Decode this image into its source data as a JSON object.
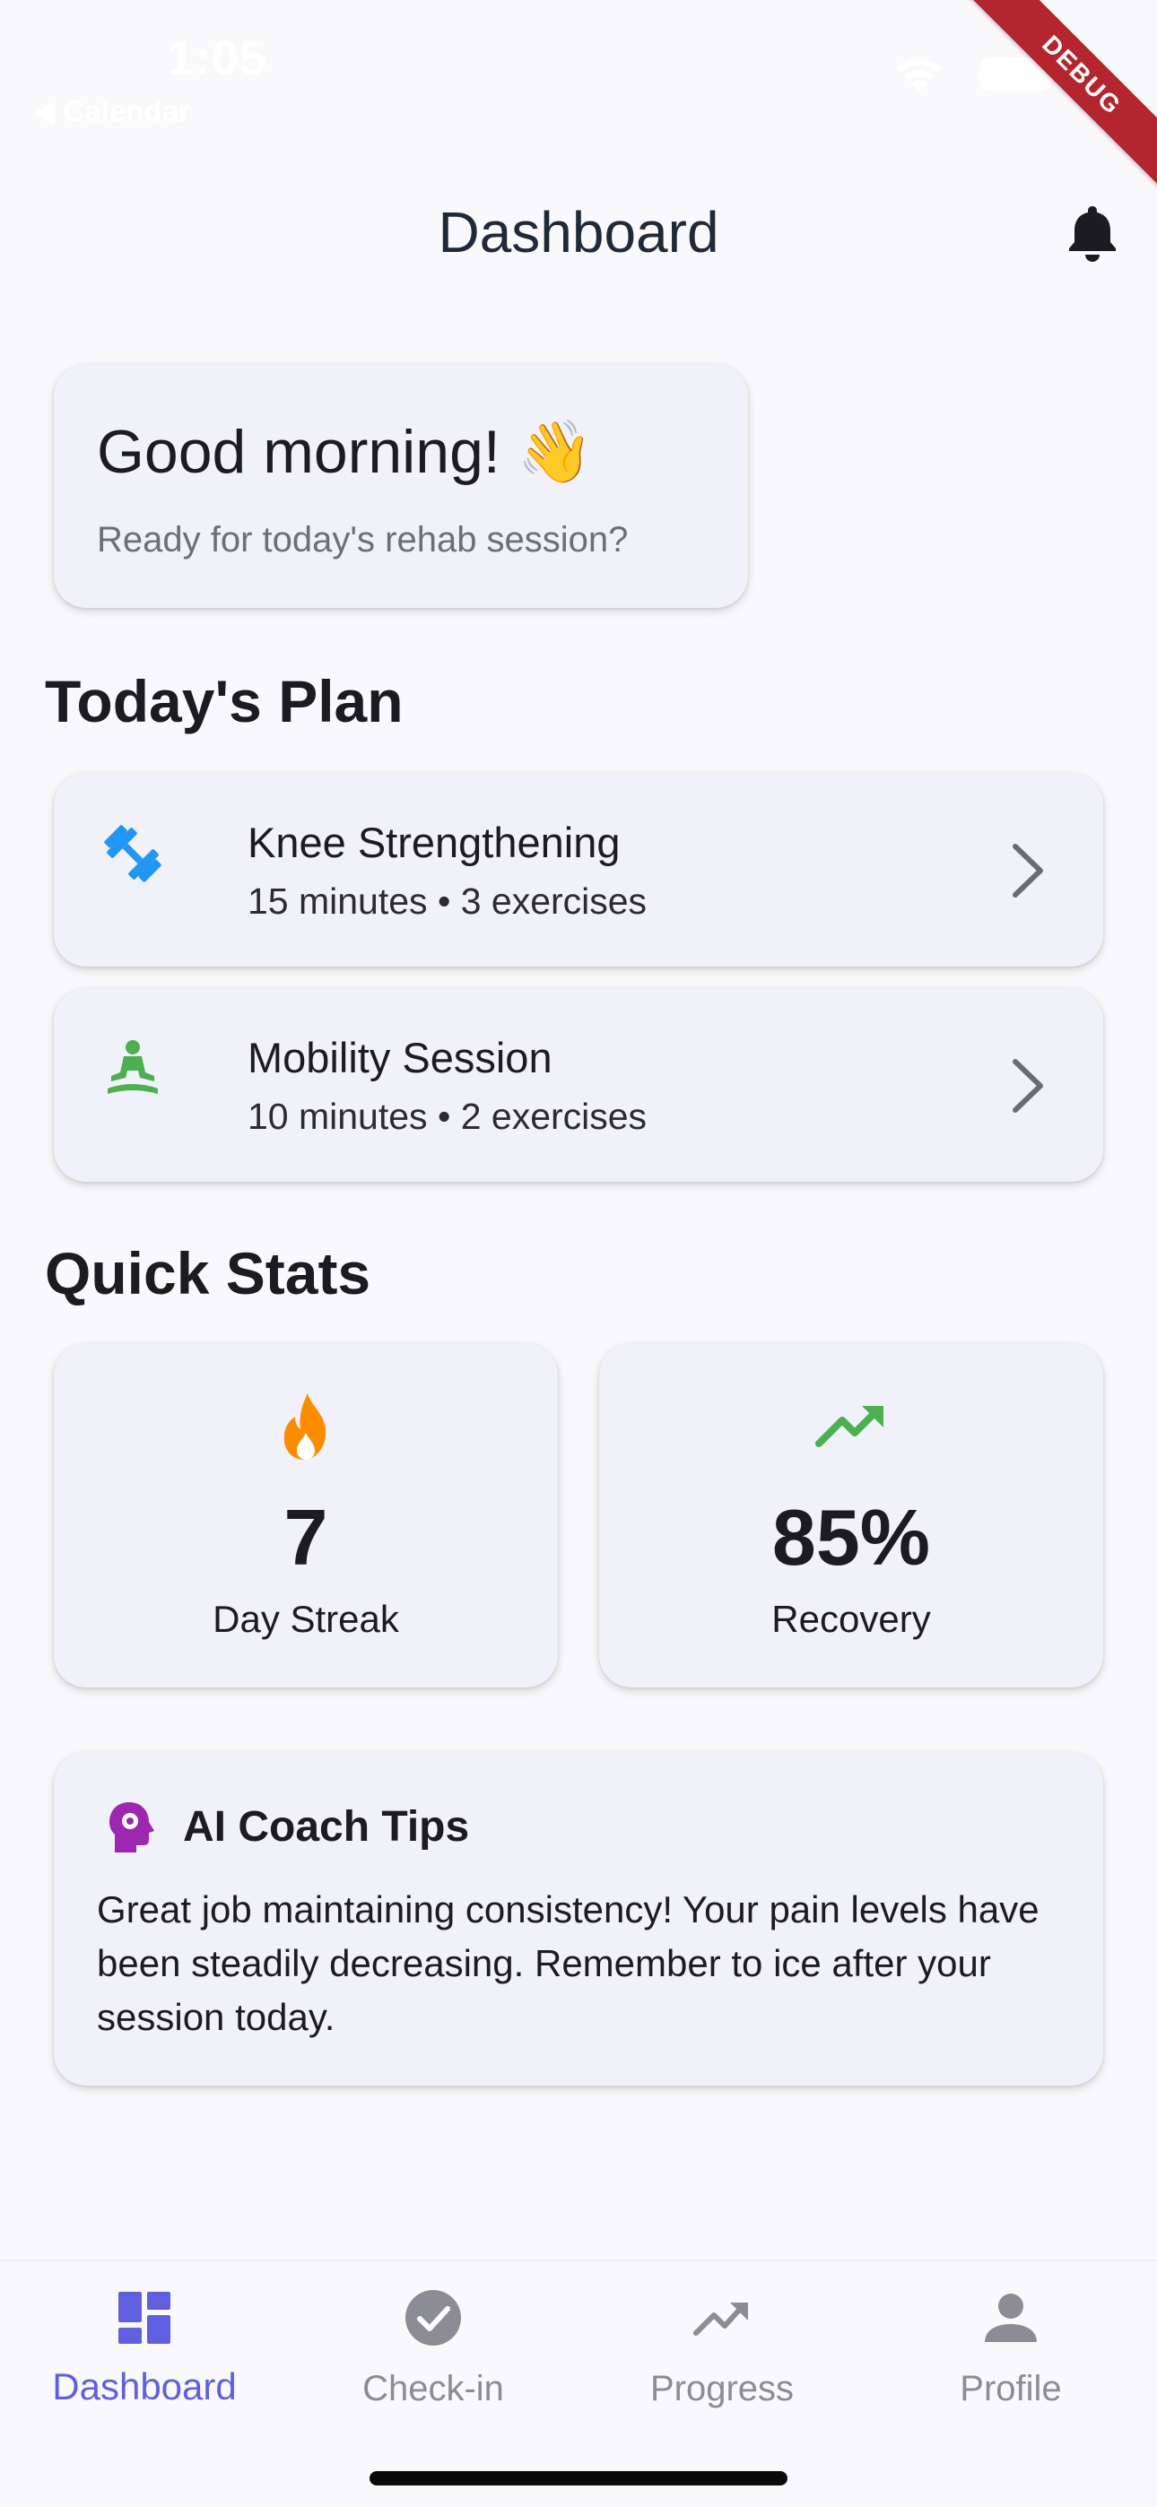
{
  "status_bar": {
    "time": "1:05",
    "back_app": "◀ Calendar"
  },
  "debug_banner": "DEBUG",
  "app_bar": {
    "title": "Dashboard"
  },
  "greeting": {
    "title": "Good morning! 👋",
    "subtitle": "Ready for today's rehab session?"
  },
  "todays_plan": {
    "heading": "Today's Plan",
    "items": [
      {
        "title": "Knee Strengthening",
        "subtitle": "15 minutes • 3 exercises",
        "icon": "dumbbell-icon",
        "icon_color": "#2196f3"
      },
      {
        "title": "Mobility Session",
        "subtitle": "10 minutes • 2 exercises",
        "icon": "meditation-icon",
        "icon_color": "#4caf50"
      }
    ]
  },
  "quick_stats": {
    "heading": "Quick Stats",
    "items": [
      {
        "value": "7",
        "label": "Day Streak",
        "icon": "fire-icon",
        "icon_color": "#fb8c00"
      },
      {
        "value": "85%",
        "label": "Recovery",
        "icon": "trending-up-icon",
        "icon_color": "#4caf50"
      }
    ]
  },
  "coach_tips": {
    "title": "AI Coach Tips",
    "icon": "psychology-icon",
    "icon_color": "#9c27b0",
    "body": "Great job maintaining consistency! Your pain levels have been steadily decreasing. Remember to ice after your session today."
  },
  "bottom_nav": {
    "active_color": "#5f5fe0",
    "inactive_color": "#8c8c94",
    "items": [
      {
        "label": "Dashboard",
        "icon": "dashboard-icon",
        "active": true
      },
      {
        "label": "Check-in",
        "icon": "check-circle-icon",
        "active": false
      },
      {
        "label": "Progress",
        "icon": "trending-up-icon",
        "active": false
      },
      {
        "label": "Profile",
        "icon": "person-icon",
        "active": false
      }
    ]
  }
}
